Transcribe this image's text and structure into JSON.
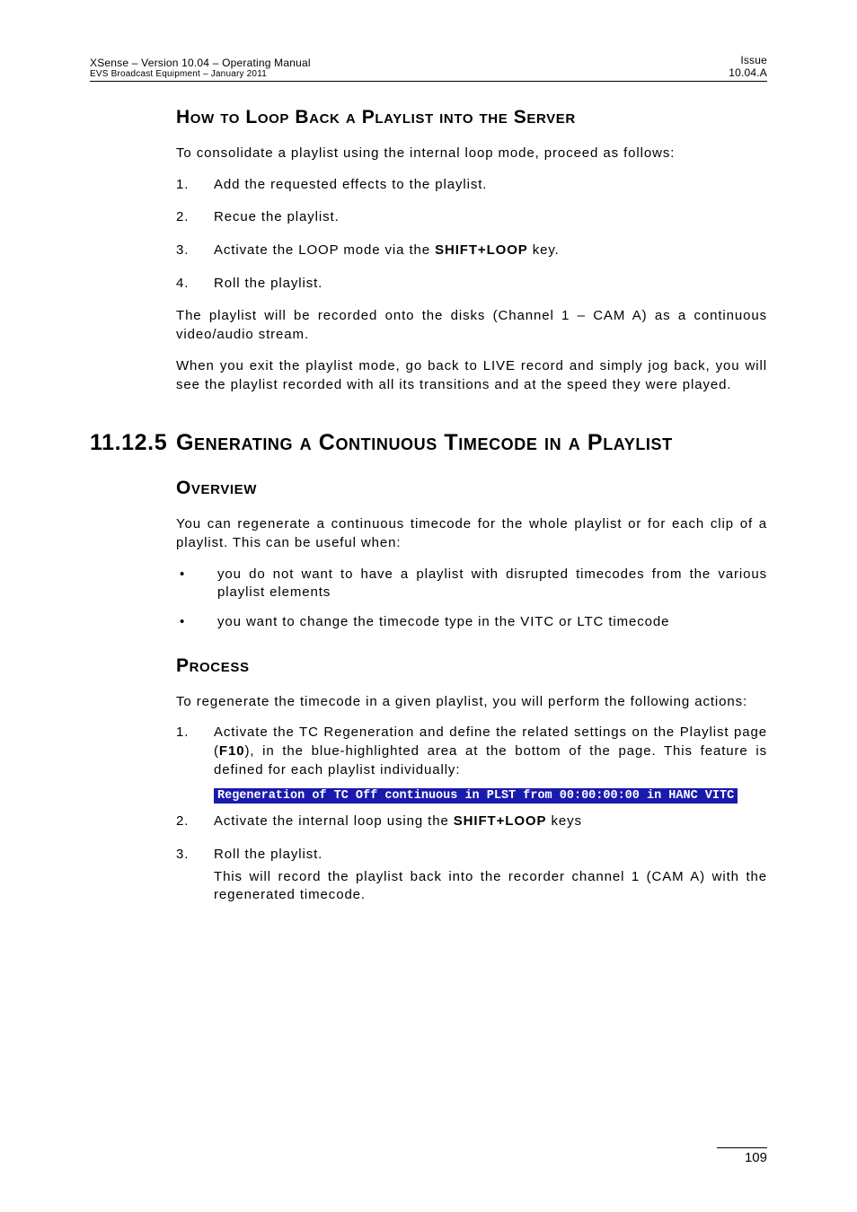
{
  "header": {
    "left_line1": "XSense – Version 10.04 – Operating Manual",
    "left_line2": "EVS Broadcast Equipment  – January 2011",
    "right_line1": "Issue",
    "right_line2": "10.04.A"
  },
  "sec1": {
    "title": "How to Loop Back a Playlist into the Server",
    "intro": "To consolidate a playlist using the internal loop mode, proceed as follows:",
    "steps": [
      "Add the requested effects to the playlist.",
      "Recue the playlist.",
      "Activate the LOOP mode via the ",
      "Roll the playlist."
    ],
    "step3_bold": "SHIFT+LOOP",
    "step3_tail": " key.",
    "p_after1": "The playlist will be recorded onto the disks (Channel 1 – CAM A) as a continuous video/audio stream.",
    "p_after2": "When you exit the playlist mode, go back to LIVE record and simply jog back, you will see the playlist recorded with all its transitions and at the speed they were played."
  },
  "sec2": {
    "num": "11.12.5",
    "title": "Generating a Continuous Timecode in a Playlist",
    "overview_h": "Overview",
    "overview_p": "You can regenerate a continuous timecode for the whole playlist or for each clip of a playlist. This can be useful when:",
    "overview_b1": "you do not want to have a playlist with disrupted timecodes from the various playlist elements",
    "overview_b2": "you want to change the timecode type in the VITC or LTC timecode",
    "process_h": "Process",
    "process_p": "To regenerate the timecode in a given playlist, you will perform the following actions:",
    "s1_a": "Activate the TC Regeneration and define the related settings on the Playlist page (",
    "s1_bold": "F10",
    "s1_b": "), in the blue-highlighted area at the bottom of the page. This feature is defined for each playlist individually:",
    "s1_code": "Regeneration of TC Off continuous in PLST  from 00:00:00:00 in HANC VITC",
    "s2_a": "Activate the internal loop using the ",
    "s2_bold": "SHIFT+LOOP",
    "s2_b": " keys",
    "s3": "Roll the playlist.",
    "s3_sub": "This will record the playlist back into the recorder channel 1 (CAM A) with the regenerated timecode."
  },
  "footer": {
    "page": "109"
  }
}
